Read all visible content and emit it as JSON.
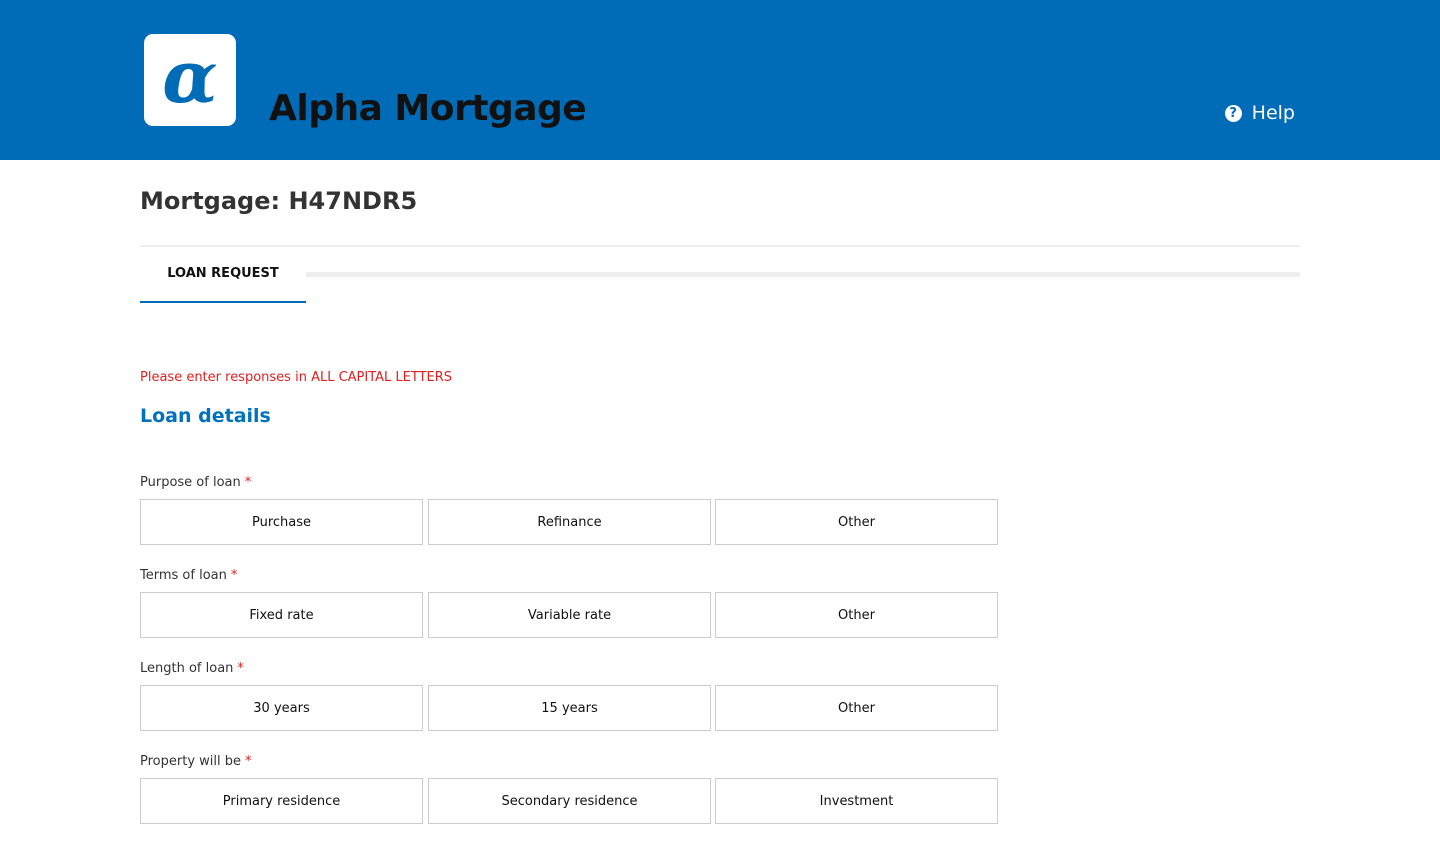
{
  "header": {
    "logo_glyph": "α",
    "brand": "Alpha Mortgage",
    "help_icon_glyph": "?",
    "help_label": "Help",
    "background_color": "#006cb7"
  },
  "page": {
    "title": "Mortgage: H47NDR5"
  },
  "tabs": [
    {
      "label": "LOAN REQUEST",
      "active": true
    }
  ],
  "form": {
    "notice": "Please enter responses in ALL CAPITAL LETTERS",
    "section_title": "Loan details",
    "required_marker": "*",
    "fields": [
      {
        "label": "Purpose of loan",
        "options": [
          "Purchase",
          "Refinance",
          "Other"
        ]
      },
      {
        "label": "Terms of loan",
        "options": [
          "Fixed rate",
          "Variable rate",
          "Other"
        ]
      },
      {
        "label": "Length of loan",
        "options": [
          "30 years",
          "15 years",
          "Other"
        ]
      },
      {
        "label": "Property will be",
        "options": [
          "Primary residence",
          "Secondary residence",
          "Investment"
        ]
      }
    ]
  },
  "colors": {
    "brand_blue": "#006cb7",
    "link_blue": "#0071bc",
    "error_red": "#e0201f"
  }
}
